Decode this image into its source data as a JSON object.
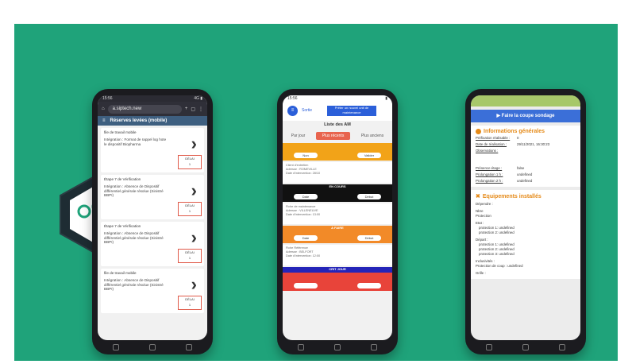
{
  "colors": {
    "background": "#1fa37a",
    "accent_blue": "#2b5fd9",
    "accent_orange": "#e58a18",
    "accent_red": "#e05a4a"
  },
  "phone1": {
    "status_time": "15:56",
    "status_icons": "4G ▮",
    "url": "a.siptech.new",
    "header_title": "Réserves levées (mobile)",
    "cards": [
      {
        "title": "file de travail mobile",
        "desc": "Intégration : Format de rappel log hote le dispositif Biopharma",
        "box_label": "DÉLAI",
        "box_value": "1"
      },
      {
        "title": "Étape 7 de Vérification",
        "desc": "Intégration : Absence de Dispositif différentiel générale résolue (Sinistré BBPI)",
        "box_label": "DÉLAI",
        "box_value": "1"
      },
      {
        "title": "Étape 7 de Vérification",
        "desc": "Intégration : Absence de Dispositif différentiel générale résolue (Sinistré BBPI)",
        "box_label": "DÉLAI",
        "box_value": "1"
      },
      {
        "title": "file de travail mobile",
        "desc": "Intégration : Absence de Dispositif différentiel générale résolue (Sinistré BBPI)",
        "box_label": "DÉLAI",
        "box_value": "1"
      }
    ]
  },
  "phone2": {
    "status_time": "15:56",
    "circle_label": "≡",
    "link_label": "Sortie",
    "top_button": "Prêter un nouvel unit de maintenance",
    "title": "Liste des AM",
    "tabs": [
      "Par jour",
      "Plus récents",
      "Plus anciens"
    ],
    "bands": [
      {
        "color": "#f2a318",
        "label": "",
        "left_pill": "Non",
        "right_pill": "Valider"
      },
      {
        "color": "#111111",
        "label": "EN COURS",
        "left_pill": "Date",
        "right_pill": "Début"
      },
      {
        "color": "#f28a28",
        "label": "A FAIRE",
        "left_pill": "Date",
        "right_pill": "Début"
      },
      {
        "color": "#2424b8",
        "label": "CRIT JOUR",
        "left_pill": "",
        "right_pill": ""
      }
    ],
    "infos": [
      {
        "line1": "Client d'entretien",
        "line2": "Adresse : ROMEVILLE",
        "line3": "Date d'intervention: 28/10"
      },
      {
        "line1": "Fiche de maintenance",
        "line2": "Adresse : VILLENEUVE",
        "line3": "Date d'intervention: 13:00"
      },
      {
        "line1": "Fiche Référence",
        "line2": "Adresse : BELFORT",
        "line3": "Date d'intervention: 12:00"
      }
    ]
  },
  "phone3": {
    "top_button": "▶ Faire la coupe sondage",
    "section1_title": "Informations générales",
    "rows": [
      {
        "k": "Préfixation réalisable :",
        "v": "0"
      },
      {
        "k": "Date de réalisation :",
        "v": "29/11/2021, 16:30:23"
      },
      {
        "k": "Observations :",
        "v": ""
      }
    ],
    "rows2": [
      {
        "k": "Présence étage :",
        "v": "false"
      },
      {
        "k": "Prolongation 1 h :",
        "v": "undefined"
      },
      {
        "k": "Prolongation 2 h :",
        "v": "undefined"
      }
    ],
    "section2_title": "Equipements installés",
    "lines": [
      "Dépendre :",
      "Nbre",
      "Protection",
      "Etat :",
      "protection 1: undefined",
      "protection 2: undefined",
      "Départ :",
      "protection 1: undefined",
      "protection 2: undefined",
      "protection 3: undefined",
      "Inclusivités :",
      "Protection de coup : undefined",
      "Grille :"
    ]
  },
  "hex_icon": "network-icon"
}
